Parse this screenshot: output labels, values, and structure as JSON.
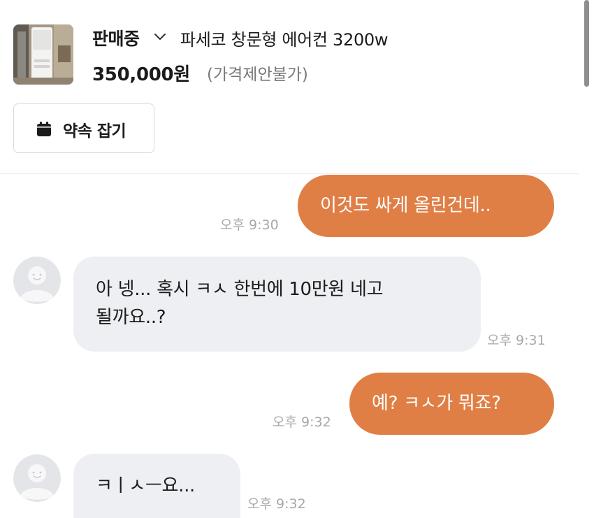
{
  "header": {
    "status": "판매중",
    "product_title": "파세코 창문형 에어컨 3200w",
    "price": "350,000원",
    "price_note": "(가격제안불가)",
    "appointment_label": "약속 잡기"
  },
  "messages": [
    {
      "sender": "me",
      "text": "이것도 싸게 올린건데..",
      "time": "오후 9:30"
    },
    {
      "sender": "other",
      "lines": [
        "아 넹... 혹시 ㅋㅅ 한번에 10만원 네고",
        "될까요..?"
      ],
      "time": "오후 9:31"
    },
    {
      "sender": "me",
      "text": "예? ㅋㅅ가 뭐죠?",
      "time": "오후 9:32"
    },
    {
      "sender": "other",
      "text": "ㅋㅣㅅㅡ요...",
      "time": "오후 9:32"
    }
  ],
  "colors": {
    "my_bubble": "#e07f45",
    "other_bubble": "#eeeff2",
    "timestamp": "#a8a8a8",
    "avatar_bg": "#e4e5e9"
  },
  "icons": {
    "status_dropdown": "chevron-down-icon",
    "appointment": "calendar-icon",
    "avatar": "default-profile-icon"
  }
}
